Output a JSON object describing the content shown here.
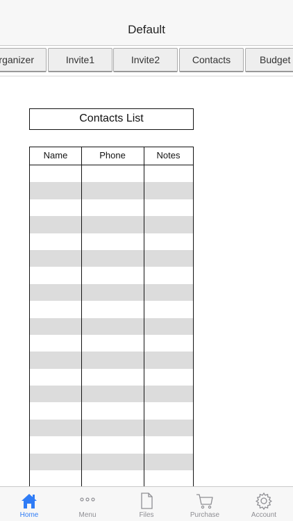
{
  "nav": {
    "title": "Default"
  },
  "tabs": [
    {
      "label": "Organizer"
    },
    {
      "label": "Invite1"
    },
    {
      "label": "Invite2"
    },
    {
      "label": "Contacts"
    },
    {
      "label": "Budget"
    }
  ],
  "contacts": {
    "title": "Contacts List",
    "columns": [
      "Name",
      "Phone",
      "Notes"
    ]
  },
  "tabbar": {
    "items": [
      {
        "label": "Home",
        "icon": "home-icon"
      },
      {
        "label": "Menu",
        "icon": "more-icon"
      },
      {
        "label": "Files",
        "icon": "file-icon"
      },
      {
        "label": "Purchase",
        "icon": "cart-icon"
      },
      {
        "label": "Account",
        "icon": "gear-icon"
      }
    ]
  },
  "colors": {
    "accent": "#2f7cf6",
    "inactive": "#8e8e93",
    "row_alt": "#dcdcdc"
  }
}
